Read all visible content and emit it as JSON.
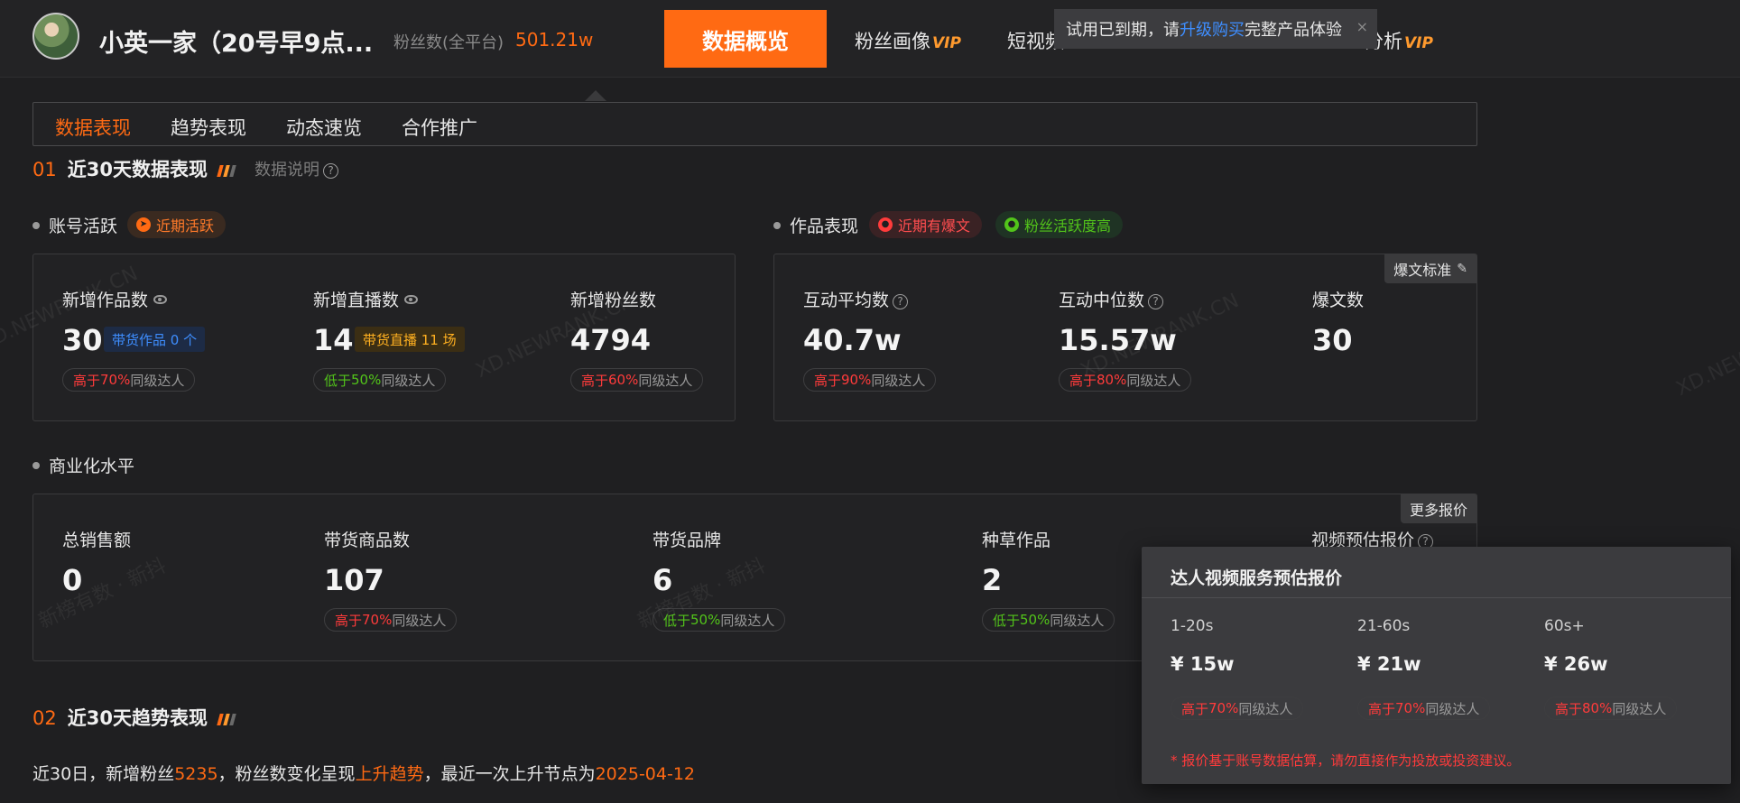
{
  "header": {
    "account_name": "小英一家（20号早9点...",
    "fans_label": "粉丝数(全平台)",
    "fans_value": "501.21w",
    "nav": {
      "active": "数据概览",
      "items": [
        {
          "label": "粉丝画像",
          "vip": "VIP"
        },
        {
          "label": "短视频",
          "vip": ""
        },
        {
          "label": "分析",
          "vip": "VIP"
        }
      ]
    },
    "trial_toast": {
      "prefix": "试用已到期，请",
      "link": "升级购买",
      "suffix": "完整产品体验",
      "close": "×"
    }
  },
  "subtabs": [
    "数据表现",
    "趋势表现",
    "动态速览",
    "合作推广"
  ],
  "section1": {
    "num": "01",
    "title": "近30天数据表现",
    "note": "数据说明",
    "stripe_colors": [
      "#ff6a13",
      "#ff9a2e",
      "#6a6a6a"
    ]
  },
  "activity": {
    "label": "账号活跃",
    "tag": "近期活跃",
    "metrics": [
      {
        "label": "新增作品数",
        "value": "30",
        "badge": "带货作品 0 个",
        "cmp_pre": "高于",
        "cmp_pct": "70%",
        "cmp_post": "同级达人",
        "dir": "hi"
      },
      {
        "label": "新增直播数",
        "value": "14",
        "badge": "带货直播 11 场",
        "cmp_pre": "低于",
        "cmp_pct": "50%",
        "cmp_post": "同级达人",
        "dir": "lo"
      },
      {
        "label": "新增粉丝数",
        "value": "4794",
        "badge": "",
        "cmp_pre": "高于",
        "cmp_pct": "60%",
        "cmp_post": "同级达人",
        "dir": "hi"
      }
    ]
  },
  "works": {
    "label": "作品表现",
    "tags": [
      "近期有爆文",
      "粉丝活跃度高"
    ],
    "corner": "爆文标准",
    "metrics": [
      {
        "label": "互动平均数",
        "value": "40.7w",
        "cmp_pre": "高于",
        "cmp_pct": "90%",
        "cmp_post": "同级达人"
      },
      {
        "label": "互动中位数",
        "value": "15.57w",
        "cmp_pre": "高于",
        "cmp_pct": "80%",
        "cmp_post": "同级达人"
      },
      {
        "label": "爆文数",
        "value": "30"
      }
    ]
  },
  "commerce": {
    "label": "商业化水平",
    "corner": "更多报价",
    "metrics": [
      {
        "label": "总销售额",
        "value": "0"
      },
      {
        "label": "带货商品数",
        "value": "107",
        "cmp_pre": "高于",
        "cmp_pct": "70%",
        "cmp_post": "同级达人",
        "dir": "hi"
      },
      {
        "label": "带货品牌",
        "value": "6",
        "cmp_pre": "低于",
        "cmp_pct": "50%",
        "cmp_post": "同级达人",
        "dir": "lo"
      },
      {
        "label": "种草作品",
        "value": "2",
        "cmp_pre": "低于",
        "cmp_pct": "50%",
        "cmp_post": "同级达人",
        "dir": "lo"
      },
      {
        "label": "视频预估报价"
      }
    ]
  },
  "section2": {
    "num": "02",
    "title": "近30天趋势表现"
  },
  "trend": {
    "p1": "近30日，新增粉丝",
    "fans": "5235",
    "p2": "，粉丝数变化呈现",
    "trend": "上升趋势",
    "p3": "，最近一次上升节点为",
    "date": "2025-04-12"
  },
  "popover": {
    "title": "达人视频服务预估报价",
    "cols": [
      {
        "label": "1-20s",
        "value": "¥ 15w",
        "cmp_pre": "高于",
        "cmp_pct": "70%",
        "cmp_post": "同级达人"
      },
      {
        "label": "21-60s",
        "value": "¥ 21w",
        "cmp_pre": "高于",
        "cmp_pct": "70%",
        "cmp_post": "同级达人"
      },
      {
        "label": "60s+",
        "value": "¥ 26w",
        "cmp_pre": "高于",
        "cmp_pct": "80%",
        "cmp_post": "同级达人"
      }
    ],
    "note": "* 报价基于账号数据估算，请勿直接作为投放或投资建议。"
  },
  "watermarks": [
    "XD.NEWRANK.CN",
    "新榜有数 · 新抖"
  ]
}
